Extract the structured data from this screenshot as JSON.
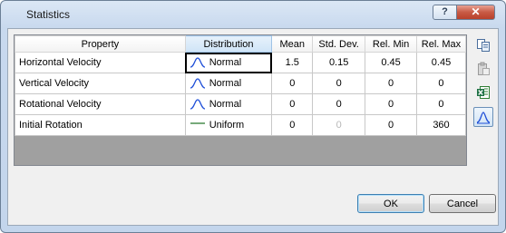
{
  "dialog": {
    "title": "Statistics",
    "help_label": "?",
    "close_label": "✕"
  },
  "grid": {
    "columns": [
      "Property",
      "Distribution",
      "Mean",
      "Std. Dev.",
      "Rel. Min",
      "Rel. Max"
    ],
    "rows": [
      {
        "property": "Horizontal Velocity",
        "distribution": "Normal",
        "mean": "1.5",
        "std_dev": "0.15",
        "rel_min": "0.45",
        "rel_max": "0.45"
      },
      {
        "property": "Vertical Velocity",
        "distribution": "Normal",
        "mean": "0",
        "std_dev": "0",
        "rel_min": "0",
        "rel_max": "0"
      },
      {
        "property": "Rotational Velocity",
        "distribution": "Normal",
        "mean": "0",
        "std_dev": "0",
        "rel_min": "0",
        "rel_max": "0"
      },
      {
        "property": "Initial Rotation",
        "distribution": "Uniform",
        "mean": "0",
        "std_dev": "0",
        "rel_min": "0",
        "rel_max": "360"
      }
    ]
  },
  "side_toolbar": [
    "copy-icon",
    "paste-icon",
    "excel-export-icon",
    "distribution-plot-icon"
  ],
  "buttons": {
    "ok_label": "OK",
    "cancel_label": "Cancel"
  },
  "colors": {
    "curve_blue": "#1f4fd8",
    "uniform_green": "#2e7d32",
    "header_selected": "#cfe4f7"
  }
}
